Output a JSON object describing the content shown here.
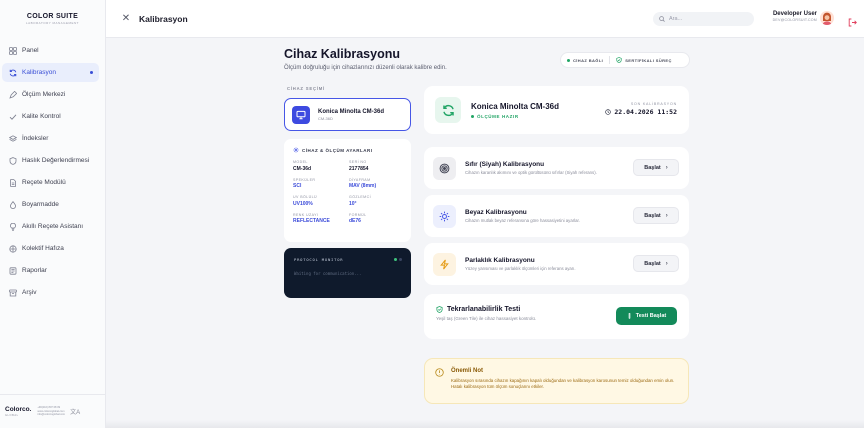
{
  "app": {
    "brand": "COLOR SUITE",
    "brand_sub": "LABORATORY MANAGEMENT",
    "colors": {
      "accent": "#3a4fd6",
      "success": "#22a566",
      "dark": "#0f1a2c",
      "warning_bg": "#fff8e4"
    }
  },
  "sidebar": {
    "items": [
      {
        "label": "Panel",
        "icon": "grid-icon"
      },
      {
        "label": "Kalibrasyon",
        "icon": "refresh-icon",
        "active": true
      },
      {
        "label": "Ölçüm Merkezi",
        "icon": "pen-icon"
      },
      {
        "label": "Kalite Kontrol",
        "icon": "check-icon"
      },
      {
        "label": "İndeksler",
        "icon": "layers-icon"
      },
      {
        "label": "Haslık Değerlendirmesi",
        "icon": "shield-icon"
      },
      {
        "label": "Reçete Modülü",
        "icon": "file-icon"
      },
      {
        "label": "Boyarmadde",
        "icon": "drop-icon"
      },
      {
        "label": "Akıllı Reçete Asistanı",
        "icon": "bulb-icon"
      },
      {
        "label": "Kolektif Hafıza",
        "icon": "brain-icon"
      },
      {
        "label": "Raporlar",
        "icon": "report-icon"
      },
      {
        "label": "Arşiv",
        "icon": "archive-icon"
      }
    ],
    "footer": {
      "logo": "Colorco.",
      "logo_sub": "GLOBAL",
      "contact_1": "+90(216) 807 08 09",
      "contact_2": "www.colorcoglobal.com",
      "contact_3": "info@colorcoglobal.com",
      "lang": "文A"
    }
  },
  "topbar": {
    "title": "Kalibrasyon",
    "search_placeholder": "Ara...",
    "user_name": "Developer User",
    "user_email": "DEV@COLORSUIT.COM"
  },
  "main": {
    "title": "Cihaz Kalibrasyonu",
    "subtitle": "Ölçüm doğruluğu için cihazlarınızı düzenli olarak kalibre edin.",
    "status_pill": {
      "connected": "CİHAZ BAĞLI",
      "certified": "SERTİFİKALI SÜREÇ"
    },
    "device_section_label": "CİHAZ SEÇİMİ",
    "device": {
      "name": "Konica Minolta CM-36d",
      "code": "CM-36D"
    },
    "settings": {
      "title": "CİHAZ & ÖLÇÜM AYARLARI",
      "fields": [
        {
          "label": "MODEL",
          "value": "CM-36d",
          "blue": false
        },
        {
          "label": "SERİ NO",
          "value": "2177854",
          "blue": false
        },
        {
          "label": "SPEKÜLER",
          "value": "SCI",
          "blue": true
        },
        {
          "label": "DİYAFRAM",
          "value": "MAV (8mm)",
          "blue": true
        },
        {
          "label": "UV BÖLÜLÜ",
          "value": "UV100%",
          "blue": true
        },
        {
          "label": "GÖZLEMCİ",
          "value": "10°",
          "blue": true
        },
        {
          "label": "RENK UZAYI",
          "value": "REFLECTANCE",
          "blue": true
        },
        {
          "label": "FORMÜL",
          "value": "dE76",
          "blue": true
        }
      ]
    },
    "monitor": {
      "title": "PROTOCOL MONITOR",
      "text": "Waiting for communication..."
    },
    "status_card": {
      "device_name": "Konica Minolta CM-36d",
      "ready": "ÖLÇÜME HAZIR",
      "last_cal_label": "SON KALİBRASYON",
      "last_cal_value": "22.04.2026 11:52"
    },
    "calibrations": [
      {
        "title": "Sıfır (Siyah) Kalibrasyonu",
        "desc": "Cihazın karanlık akımını ve optik gürültüsünü sıfırlar (Siyah referans).",
        "button": "Başlat",
        "icon": "target-icon"
      },
      {
        "title": "Beyaz Kalibrasyonu",
        "desc": "Cihazın mutlak beyaz referansına göre hassasiyetini ayarlar.",
        "button": "Başlat",
        "icon": "sun-icon"
      },
      {
        "title": "Parlaklık Kalibrasyonu",
        "desc": "Yüzey yansıması ve parlaklık ölçümleri için referans ayarı.",
        "button": "Başlat",
        "icon": "bolt-icon"
      }
    ],
    "repeat": {
      "title": "Tekrarlanabilirlik Testi",
      "desc": "Yeşil taş (Green Tile) ile cihaz hassasiyet kontrolü.",
      "button": "Testi Başlat"
    },
    "note": {
      "title": "Önemli Not",
      "text": "Kalibrasyon sırasında cihazın kapağının kapalı olduğundan ve kalibrasyon karosunun temiz olduğundan emin olun. Hatalı kalibrasyon tüm ölçüm sonuçlarını etkiler."
    }
  }
}
